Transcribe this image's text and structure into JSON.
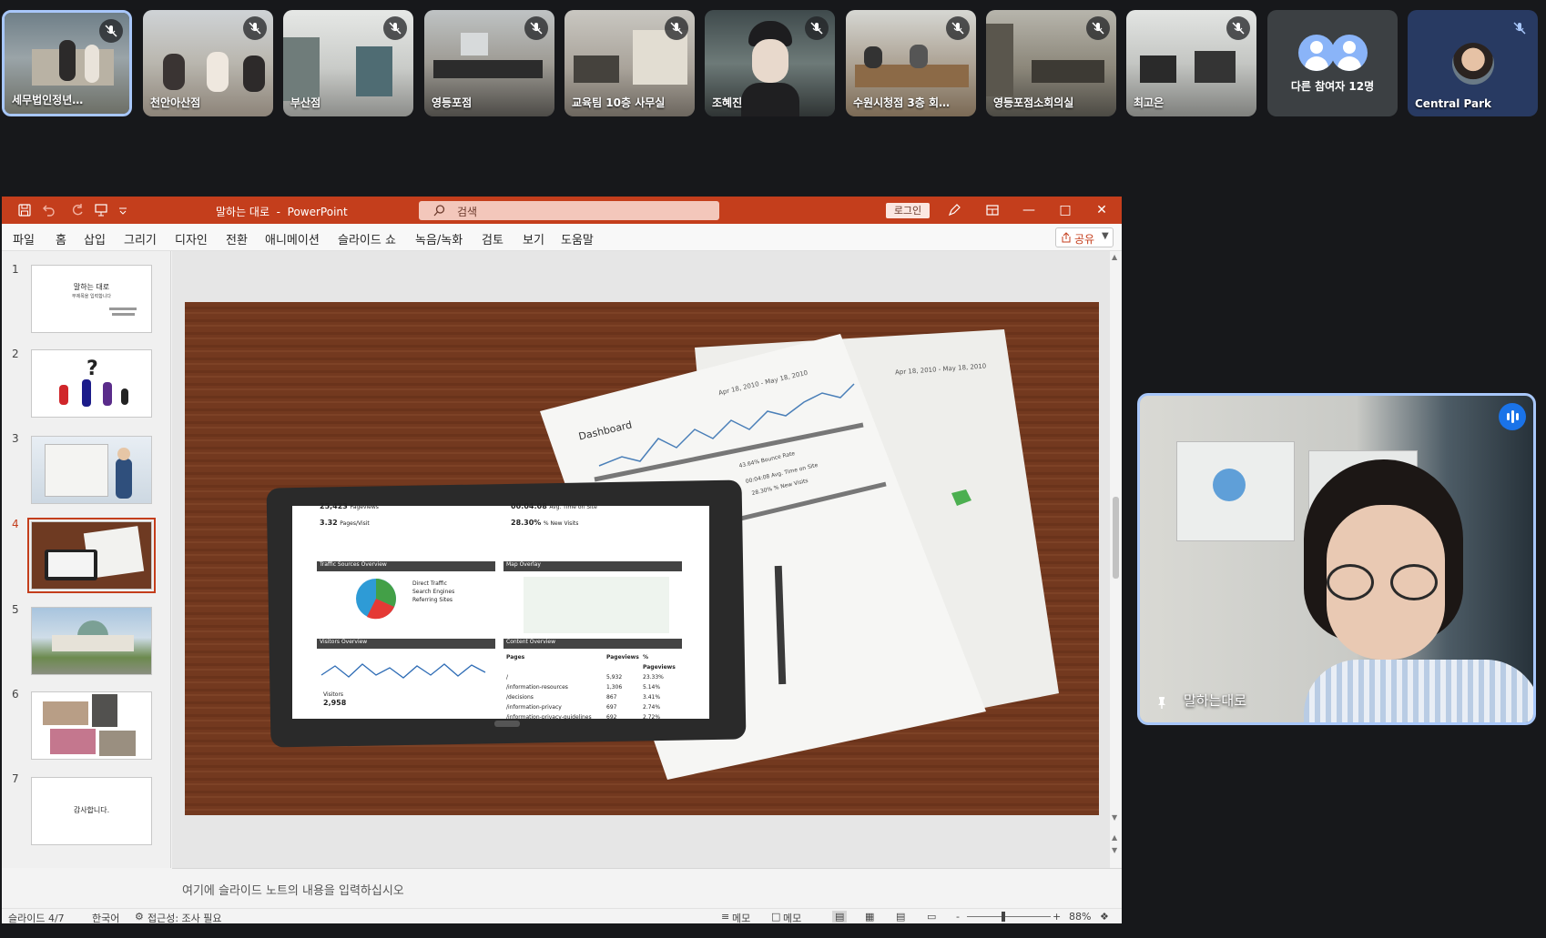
{
  "participants": [
    {
      "name": "세무법인정년…",
      "muted": true,
      "active": true
    },
    {
      "name": "천안아산점",
      "muted": true
    },
    {
      "name": "부산점",
      "muted": true
    },
    {
      "name": "영등포점",
      "muted": true
    },
    {
      "name": "교육팀 10층 사무실",
      "muted": true
    },
    {
      "name": "조혜진",
      "muted": true
    },
    {
      "name": "수원시청점 3층 회…",
      "muted": true
    },
    {
      "name": "영등포점소회의실",
      "muted": true
    },
    {
      "name": "최고은",
      "muted": true
    }
  ],
  "others_label": "다른 참여자 12명",
  "central_park": {
    "name": "Central Park",
    "muted": true
  },
  "powerpoint": {
    "doc_title": "말하는 대로",
    "app_name": "PowerPoint",
    "title_separator": "-",
    "search_placeholder": "검색",
    "login_label": "로그인",
    "ribbon_tabs": [
      "파일",
      "홈",
      "삽입",
      "그리기",
      "디자인",
      "전환",
      "애니메이션",
      "슬라이드 쇼",
      "녹음/녹화",
      "검토",
      "보기",
      "도움말"
    ],
    "share_label": "공유",
    "thumbnails": [
      {
        "num": "1",
        "title": "말하는 대로",
        "subtitle": "부제목을 입력합니다"
      },
      {
        "num": "2"
      },
      {
        "num": "3"
      },
      {
        "num": "4",
        "selected": true
      },
      {
        "num": "5"
      },
      {
        "num": "6"
      },
      {
        "num": "7",
        "text": "감사합니다."
      }
    ],
    "notes_placeholder": "여기에 슬라이드 노트의 내용을 입력하십시오",
    "status": {
      "slide_info": "슬라이드 4/7",
      "language": "한국어",
      "accessibility": "접근성: 조사 필요",
      "notes_btn": "메모",
      "comments_btn": "메모",
      "zoom_minus": "-",
      "zoom_plus": "+",
      "zoom": "88%"
    },
    "slide4": {
      "tablet": {
        "stat1_value": "25,423",
        "stat1_label": "Pageviews",
        "stat2_value": "3.32",
        "stat2_label": "Pages/Visit",
        "stat3_value": "00:04:08",
        "stat3_label": "Avg. Time on Site",
        "stat4_value": "28.30%",
        "stat4_label": "% New Visits",
        "traffic_title": "Traffic Sources Overview",
        "traffic_legend": [
          "Direct Traffic",
          "Search Engines",
          "Referring Sites"
        ],
        "map_title": "Map Overlay",
        "visitors_title": "Visitors Overview",
        "visitors_label": "Visitors",
        "visitors_value": "2,958",
        "content_title": "Content Overview",
        "content_headers": [
          "Pages",
          "Pageviews",
          "% Pageviews"
        ],
        "content_rows": [
          [
            "/",
            "5,932",
            "23.33%"
          ],
          [
            "/information-resources",
            "1,306",
            "5.14%"
          ],
          [
            "/decisions",
            "867",
            "3.41%"
          ],
          [
            "/information-privacy",
            "697",
            "2.74%"
          ],
          [
            "/information-privacy-guidelines",
            "692",
            "2.72%"
          ]
        ]
      },
      "paper": {
        "dashboard_title": "Dashboard",
        "date_range": "Apr 18, 2010 - May 18, 2010",
        "stat_a": "43.64% Bounce Rate",
        "stat_b": "00:04:08 Avg. Time on Site",
        "stat_c": "28.30% % New Visits"
      }
    }
  },
  "speaker": {
    "name": "말하는대로"
  },
  "colors": {
    "ppt_accent": "#c43e1c",
    "meet_bg": "#17181b",
    "highlight": "#a8c7fa"
  }
}
